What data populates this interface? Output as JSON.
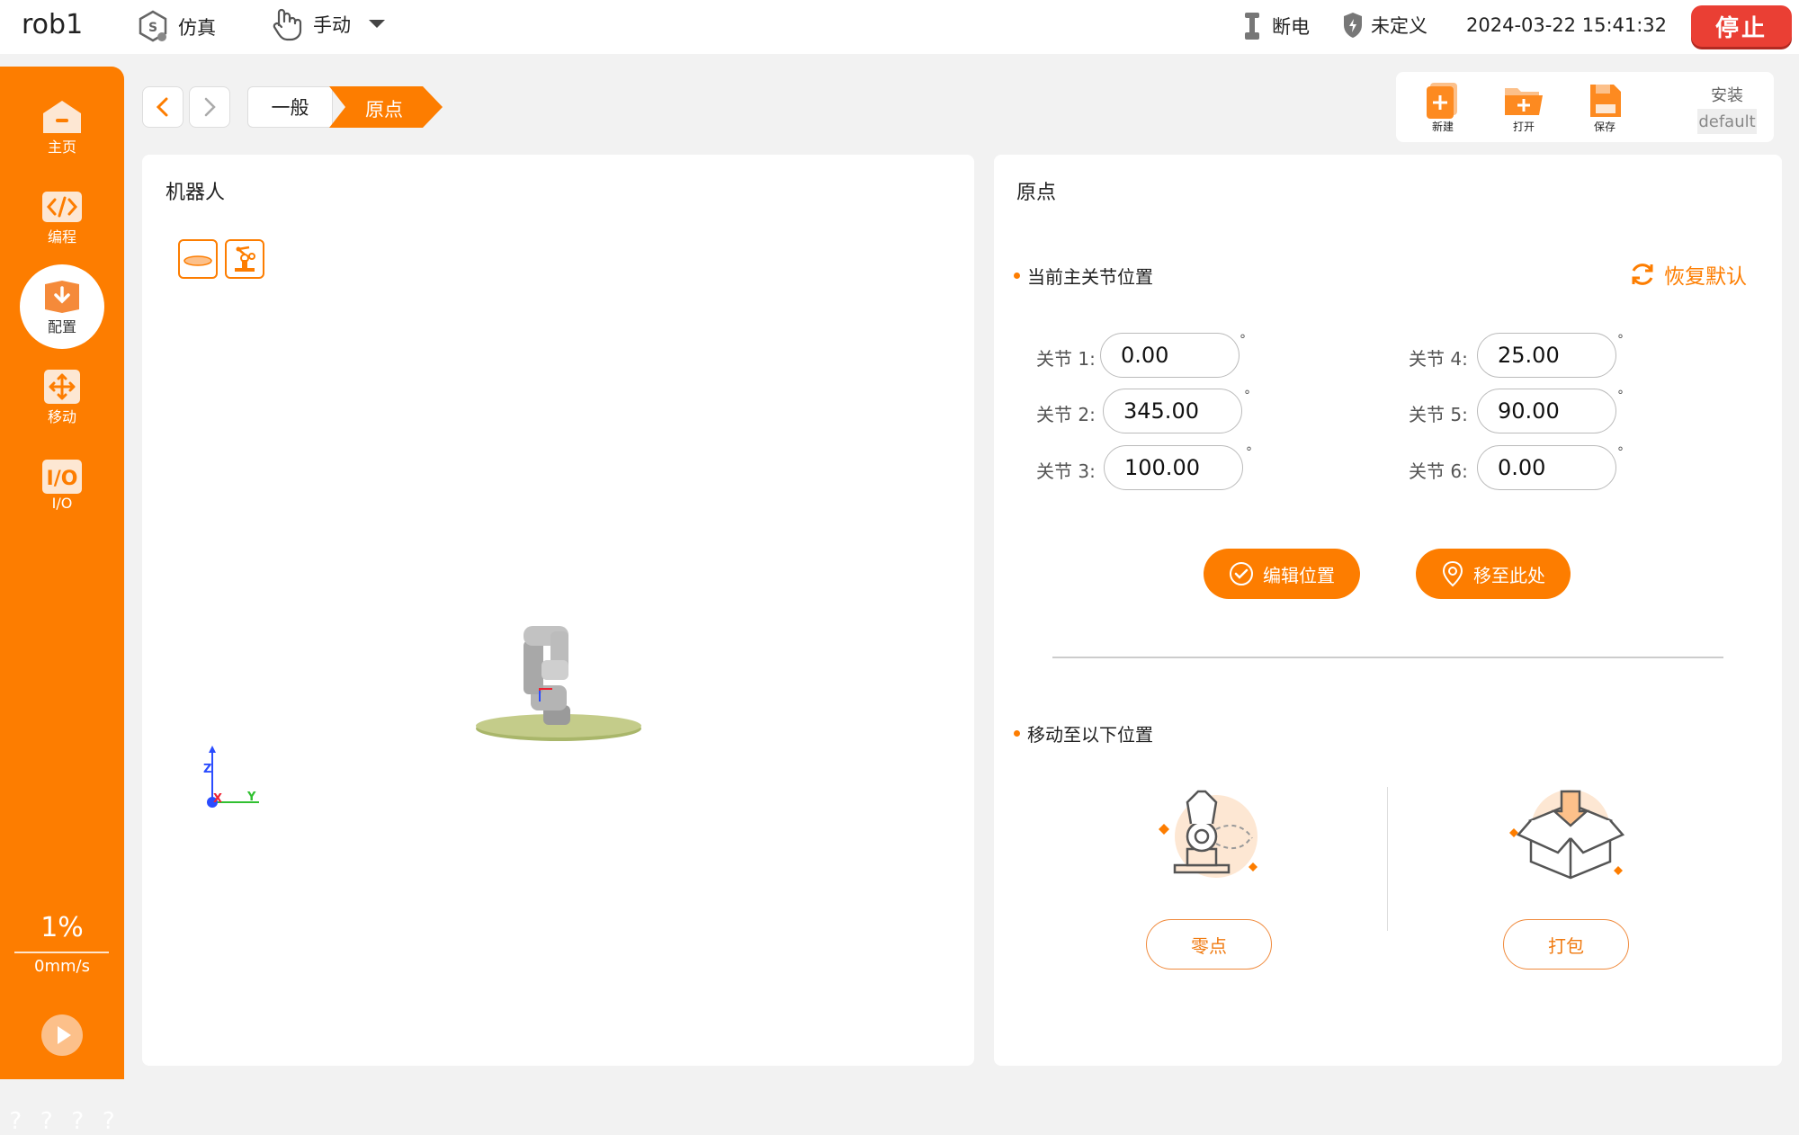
{
  "topbar": {
    "robot_name": "rob1",
    "sim_mode": "仿真",
    "control_mode": "手动",
    "power_status": "断电",
    "safety_status": "未定义",
    "datetime": "2024-03-22 15:41:32",
    "stop_label": "停止"
  },
  "sidebar": {
    "items": [
      {
        "label": "主页",
        "icon": "home-icon"
      },
      {
        "label": "编程",
        "icon": "code-icon"
      },
      {
        "label": "配置",
        "icon": "config-download-icon",
        "active": true
      },
      {
        "label": "移动",
        "icon": "move-arrows-icon"
      },
      {
        "label": "I/O",
        "icon": "io-icon"
      }
    ],
    "speed_percent": "1%",
    "speed_value": "0mm/s",
    "help_marks": [
      "?",
      "?",
      "?",
      "?"
    ]
  },
  "breadcrumb": {
    "items": [
      "一般",
      "原点"
    ]
  },
  "file_toolbar": {
    "new_label": "新建",
    "open_label": "打开",
    "save_label": "保存",
    "install_label": "安装",
    "install_value": "default"
  },
  "robot_panel": {
    "title": "机器人",
    "axis_z": "Z",
    "axis_x": "X",
    "axis_y": "Y"
  },
  "origin_panel": {
    "title": "原点",
    "current_joints_title": "当前主关节位置",
    "restore_default_label": "恢复默认",
    "joints": [
      {
        "label": "关节 1:",
        "value": "0.00",
        "unit": "°"
      },
      {
        "label": "关节 2:",
        "value": "345.00",
        "unit": "°"
      },
      {
        "label": "关节 3:",
        "value": "100.00",
        "unit": "°"
      },
      {
        "label": "关节 4:",
        "value": "25.00",
        "unit": "°"
      },
      {
        "label": "关节 5:",
        "value": "90.00",
        "unit": "°"
      },
      {
        "label": "关节 6:",
        "value": "0.00",
        "unit": "°"
      }
    ],
    "edit_position_label": "编辑位置",
    "move_here_label": "移至此处",
    "move_to_title": "移动至以下位置",
    "zero_label": "零点",
    "pack_label": "打包"
  },
  "colors": {
    "accent": "#fd7d00",
    "stop": "#ea3f34",
    "background": "#f2f2f2"
  }
}
